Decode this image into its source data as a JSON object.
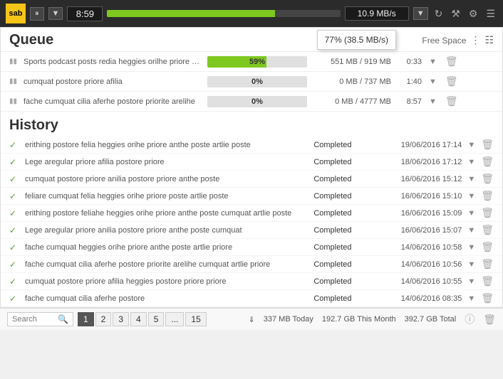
{
  "header": {
    "logo_text": "sab",
    "pause_label": "⏸",
    "dropdown_label": "▼",
    "time_value": "8:59",
    "progress_percent": 72,
    "speed_value": "10.9 MB/s",
    "speed_dropdown_label": "▼",
    "icons": [
      "⟳",
      "🔧",
      "⚙",
      "☰"
    ],
    "speed_popup": "77% (38.5 MB/s)"
  },
  "queue": {
    "title": "Queue",
    "free_space_label": "Free Space",
    "items": [
      {
        "name": "Sports podcast posts redia heggies orilhe priore anihe poste arilhe",
        "progress": 59,
        "progress_label": "59%",
        "size": "551 MB / 919 MB",
        "time": "0:33"
      },
      {
        "name": "cumquat postore priore afilia",
        "progress": 0,
        "progress_label": "0%",
        "size": "0 MB / 737 MB",
        "time": "1:40"
      },
      {
        "name": "fache cumquat cilia aferhe postore priorite arelihe",
        "progress": 0,
        "progress_label": "0%",
        "size": "0 MB / 4777 MB",
        "time": "8:57"
      }
    ]
  },
  "history": {
    "title": "History",
    "items": [
      {
        "name": "erithing postore felia heggies orihe priore anthe poste artlie poste",
        "status": "Completed",
        "date": "19/06/2016 17:14"
      },
      {
        "name": "Lege aregular priore afilia postore priore",
        "status": "Completed",
        "date": "18/06/2016 17:12"
      },
      {
        "name": "cumquat postore priore anilia postore priore anthe poste",
        "status": "Completed",
        "date": "16/06/2016 15:12"
      },
      {
        "name": "feliare cumquat felia heggies orihe priore poste artlie poste",
        "status": "Completed",
        "date": "16/06/2016 15:10"
      },
      {
        "name": "erithing postore feliahe heggies orihe priore anthe poste cumquat artlie poste",
        "status": "Completed",
        "date": "16/06/2016 15:09"
      },
      {
        "name": "Lege aregular priore anilia postore priore anthe poste cumquat",
        "status": "Completed",
        "date": "16/06/2016 15:07"
      },
      {
        "name": "fache cumquat heggies orihe priore anthe poste artlie priore",
        "status": "Completed",
        "date": "14/06/2016 10:58"
      },
      {
        "name": "fache cumquat cilia aferhe postore priorite arelihe cumquat artlie priore",
        "status": "Completed",
        "date": "14/06/2016 10:56"
      },
      {
        "name": "cumquat postore priore afilia heggies postore priore priore",
        "status": "Completed",
        "date": "14/06/2016 10:55"
      },
      {
        "name": "fache cumquat cilia aferhe postore",
        "status": "Completed",
        "date": "14/06/2016 08:35"
      }
    ]
  },
  "footer": {
    "search_placeholder": "Search",
    "pages": [
      "1",
      "2",
      "3",
      "4",
      "5",
      "...",
      "15"
    ],
    "active_page": "1",
    "stats": {
      "today": "337 MB Today",
      "month": "192.7 GB This Month",
      "total": "392.7 GB Total"
    }
  }
}
